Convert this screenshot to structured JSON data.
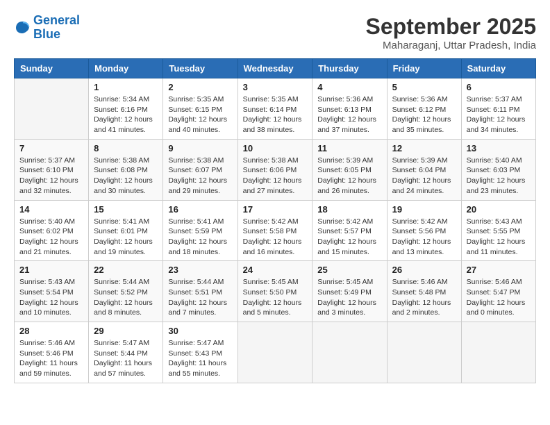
{
  "header": {
    "logo_line1": "General",
    "logo_line2": "Blue",
    "month": "September 2025",
    "location": "Maharaganj, Uttar Pradesh, India"
  },
  "weekdays": [
    "Sunday",
    "Monday",
    "Tuesday",
    "Wednesday",
    "Thursday",
    "Friday",
    "Saturday"
  ],
  "weeks": [
    [
      {
        "num": "",
        "info": ""
      },
      {
        "num": "1",
        "info": "Sunrise: 5:34 AM\nSunset: 6:16 PM\nDaylight: 12 hours\nand 41 minutes."
      },
      {
        "num": "2",
        "info": "Sunrise: 5:35 AM\nSunset: 6:15 PM\nDaylight: 12 hours\nand 40 minutes."
      },
      {
        "num": "3",
        "info": "Sunrise: 5:35 AM\nSunset: 6:14 PM\nDaylight: 12 hours\nand 38 minutes."
      },
      {
        "num": "4",
        "info": "Sunrise: 5:36 AM\nSunset: 6:13 PM\nDaylight: 12 hours\nand 37 minutes."
      },
      {
        "num": "5",
        "info": "Sunrise: 5:36 AM\nSunset: 6:12 PM\nDaylight: 12 hours\nand 35 minutes."
      },
      {
        "num": "6",
        "info": "Sunrise: 5:37 AM\nSunset: 6:11 PM\nDaylight: 12 hours\nand 34 minutes."
      }
    ],
    [
      {
        "num": "7",
        "info": "Sunrise: 5:37 AM\nSunset: 6:10 PM\nDaylight: 12 hours\nand 32 minutes."
      },
      {
        "num": "8",
        "info": "Sunrise: 5:38 AM\nSunset: 6:08 PM\nDaylight: 12 hours\nand 30 minutes."
      },
      {
        "num": "9",
        "info": "Sunrise: 5:38 AM\nSunset: 6:07 PM\nDaylight: 12 hours\nand 29 minutes."
      },
      {
        "num": "10",
        "info": "Sunrise: 5:38 AM\nSunset: 6:06 PM\nDaylight: 12 hours\nand 27 minutes."
      },
      {
        "num": "11",
        "info": "Sunrise: 5:39 AM\nSunset: 6:05 PM\nDaylight: 12 hours\nand 26 minutes."
      },
      {
        "num": "12",
        "info": "Sunrise: 5:39 AM\nSunset: 6:04 PM\nDaylight: 12 hours\nand 24 minutes."
      },
      {
        "num": "13",
        "info": "Sunrise: 5:40 AM\nSunset: 6:03 PM\nDaylight: 12 hours\nand 23 minutes."
      }
    ],
    [
      {
        "num": "14",
        "info": "Sunrise: 5:40 AM\nSunset: 6:02 PM\nDaylight: 12 hours\nand 21 minutes."
      },
      {
        "num": "15",
        "info": "Sunrise: 5:41 AM\nSunset: 6:01 PM\nDaylight: 12 hours\nand 19 minutes."
      },
      {
        "num": "16",
        "info": "Sunrise: 5:41 AM\nSunset: 5:59 PM\nDaylight: 12 hours\nand 18 minutes."
      },
      {
        "num": "17",
        "info": "Sunrise: 5:42 AM\nSunset: 5:58 PM\nDaylight: 12 hours\nand 16 minutes."
      },
      {
        "num": "18",
        "info": "Sunrise: 5:42 AM\nSunset: 5:57 PM\nDaylight: 12 hours\nand 15 minutes."
      },
      {
        "num": "19",
        "info": "Sunrise: 5:42 AM\nSunset: 5:56 PM\nDaylight: 12 hours\nand 13 minutes."
      },
      {
        "num": "20",
        "info": "Sunrise: 5:43 AM\nSunset: 5:55 PM\nDaylight: 12 hours\nand 11 minutes."
      }
    ],
    [
      {
        "num": "21",
        "info": "Sunrise: 5:43 AM\nSunset: 5:54 PM\nDaylight: 12 hours\nand 10 minutes."
      },
      {
        "num": "22",
        "info": "Sunrise: 5:44 AM\nSunset: 5:52 PM\nDaylight: 12 hours\nand 8 minutes."
      },
      {
        "num": "23",
        "info": "Sunrise: 5:44 AM\nSunset: 5:51 PM\nDaylight: 12 hours\nand 7 minutes."
      },
      {
        "num": "24",
        "info": "Sunrise: 5:45 AM\nSunset: 5:50 PM\nDaylight: 12 hours\nand 5 minutes."
      },
      {
        "num": "25",
        "info": "Sunrise: 5:45 AM\nSunset: 5:49 PM\nDaylight: 12 hours\nand 3 minutes."
      },
      {
        "num": "26",
        "info": "Sunrise: 5:46 AM\nSunset: 5:48 PM\nDaylight: 12 hours\nand 2 minutes."
      },
      {
        "num": "27",
        "info": "Sunrise: 5:46 AM\nSunset: 5:47 PM\nDaylight: 12 hours\nand 0 minutes."
      }
    ],
    [
      {
        "num": "28",
        "info": "Sunrise: 5:46 AM\nSunset: 5:46 PM\nDaylight: 11 hours\nand 59 minutes."
      },
      {
        "num": "29",
        "info": "Sunrise: 5:47 AM\nSunset: 5:44 PM\nDaylight: 11 hours\nand 57 minutes."
      },
      {
        "num": "30",
        "info": "Sunrise: 5:47 AM\nSunset: 5:43 PM\nDaylight: 11 hours\nand 55 minutes."
      },
      {
        "num": "",
        "info": ""
      },
      {
        "num": "",
        "info": ""
      },
      {
        "num": "",
        "info": ""
      },
      {
        "num": "",
        "info": ""
      }
    ]
  ]
}
